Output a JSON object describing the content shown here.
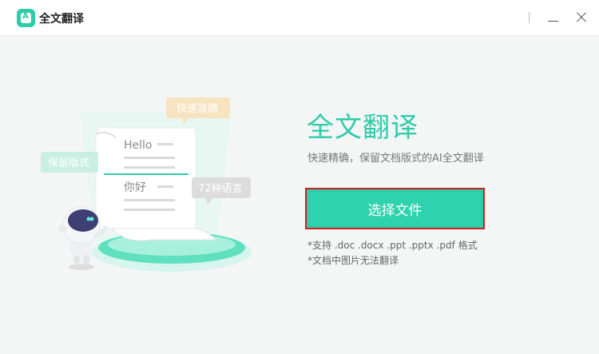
{
  "window": {
    "title": "全文翻译",
    "logo_icon": "app-logo-icon",
    "minimize_icon": "minimize-icon",
    "close_icon": "close-icon"
  },
  "illustration": {
    "bubble_top": "快速准确",
    "bubble_left": "保留版式",
    "bubble_right": "72种语言",
    "word_en": "Hello",
    "word_zh": "你好",
    "mascot_icon": "robot-mascot-icon"
  },
  "main": {
    "heading": "全文翻译",
    "subtitle": "快速精确，保留文档版式的AI全文翻译",
    "button_label": "选择文件",
    "note_formats": "*支持 .doc .docx .ppt .pptx .pdf 格式",
    "note_images": "*文档中图片无法翻译"
  },
  "colors": {
    "accent": "#2ecca9",
    "highlight_border": "#d11f1f"
  }
}
